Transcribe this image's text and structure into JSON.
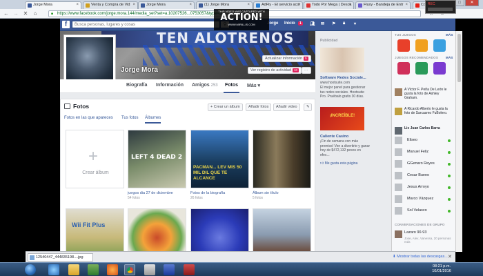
{
  "browser": {
    "tabs": [
      {
        "label": "Jorge Mora",
        "color": "#3b5998",
        "active": true
      },
      {
        "label": "Venta y Compra de Vid",
        "color": "#d0a020",
        "active": false
      },
      {
        "label": "Jorge Mora",
        "color": "#3b5998",
        "active": false
      },
      {
        "label": "(1) Jorge Mora",
        "color": "#3b5998",
        "active": false
      },
      {
        "label": "AdFly - El servicio acor",
        "color": "#2a7fd4",
        "active": false
      },
      {
        "label": "Todo Por Mega | Desca",
        "color": "#d33",
        "active": false
      },
      {
        "label": "Fluxy - Bandeja de Entr",
        "color": "#6a5acd",
        "active": false
      },
      {
        "label": "Como eliminar albumes",
        "color": "#e62117",
        "active": false
      }
    ],
    "url": "https://www.facebook.com/jorge.mora.144/media_set?set=a.10207526...0753057&type=3"
  },
  "overlay": {
    "banner_top": "THIS VIDEO WAS CAPTURED WITH",
    "banner_main": "ACTION!",
    "banner_sub": "WWW.MIRILLIS.COM"
  },
  "fb": {
    "search_placeholder": "Busca personas, lugares y cosas",
    "user": "Jorge",
    "home": "Inicio",
    "home_count": "1"
  },
  "cover": {
    "cover_text": "TEN ALOTRENOS",
    "name": "Jorge Mora",
    "update_info": "Actualizar información",
    "update_badge": "5",
    "activity_log": "Ver registro de actividad",
    "activity_badge": "10",
    "more": "···"
  },
  "nav": {
    "tabs": [
      {
        "label": "Biografía",
        "count": ""
      },
      {
        "label": "Información",
        "count": ""
      },
      {
        "label": "Amigos",
        "count": "253"
      },
      {
        "label": "Fotos",
        "count": ""
      },
      {
        "label": "Más ▾",
        "count": ""
      }
    ]
  },
  "photos": {
    "title": "Fotos",
    "create_album": "+ Crear un álbum",
    "add_photos": "Añadir fotos",
    "add_video": "Añadir video",
    "subtabs": [
      "Fotos en las que apareces",
      "Tus fotos",
      "Álbumes"
    ],
    "create_album_tile": "Crear álbum",
    "albums": [
      {
        "name": "juegos dia 27 de diciembre",
        "count": "54 fotos",
        "colors": [
          "#2e3a3f",
          "#7a8c6a",
          "#c9c9b0"
        ]
      },
      {
        "name": "Fotos de la biografía",
        "count": "26 fotos",
        "colors": [
          "#1a3d5e",
          "#3a79c2",
          "#e8d34a"
        ]
      },
      {
        "name": "Álbum sin título",
        "count": "5 fotos",
        "colors": [
          "#4a3d2a",
          "#8a7a5a",
          "#2a2a22"
        ]
      },
      {
        "name": "",
        "count": "",
        "colors": [
          "#e0ddd0",
          "#5a8f3a",
          "#c7b97a"
        ]
      },
      {
        "name": "",
        "count": "",
        "colors": [
          "#f4a23a",
          "#c94a2a",
          "#6aa84f"
        ]
      },
      {
        "name": "",
        "count": "",
        "colors": [
          "#2b3bb8",
          "#6a7ae0",
          "#1b2070"
        ]
      },
      {
        "name": "",
        "count": "",
        "colors": [
          "#8a9bb0",
          "#c4d2e0",
          "#6a4a3a"
        ]
      }
    ],
    "tile_text_l4d": "LEFT 4 DEAD 2",
    "tile_text_bio": "PACMAN... LEV MIS 50 MIL DIL QUE TE ALCANCE",
    "tile_text_wii": "Wii Fit Plus"
  },
  "ads": {
    "header": "Publicidad",
    "ad1_title": "Software Redes Sociale...",
    "ad1_url": "www.hootsuite.com",
    "ad1_body": "El mejor panel para gestionar tus redes sociales. Hootsuite Pro. Pruébalo gratis 30 días.",
    "ad2_banner": "¡INCREÍBLE!",
    "ad2_title": "Caliente Casino",
    "ad2_body": "¡Fin de semana con más premios! Ven a divertirte y ganar hoy de $472,132 pesos en efec...",
    "ad2_like": "Me gusta esta página"
  },
  "chat": {
    "games_header": "TUS JUEGOS",
    "games_more": "MÁS",
    "recent_header": "JUEGOS RECOMENDADOS",
    "recent_more": "MÁS",
    "activity": [
      "A Víctor F. Peña De León le gusta la foto de Ashley Graham.",
      "A Ricardo Alberto le gusta la foto de Sarcasmo FuBolero.",
      "Lic Juan Carlos Barra"
    ],
    "friends": [
      "Eliseo",
      "Manuel Feliz",
      "GGenaro Reyes",
      "Cesar Bueno",
      "Jesus Arroyo",
      "Marco Vázquez",
      "Sol Velasco"
    ],
    "groups_header": "CONVERSACIONES DE GRUPO",
    "groups": [
      "Lazaro 90-93",
      "Jose, Alex, Vanessa, 20 personas más"
    ]
  },
  "downloads": {
    "file": "12540447_444835198....jpg",
    "show_all": "Mostrar todas las descargas..."
  },
  "taskbar": {
    "time": "08:21 p.m.",
    "date": "10/01/2016"
  },
  "recbox": {
    "line1": "REC"
  }
}
